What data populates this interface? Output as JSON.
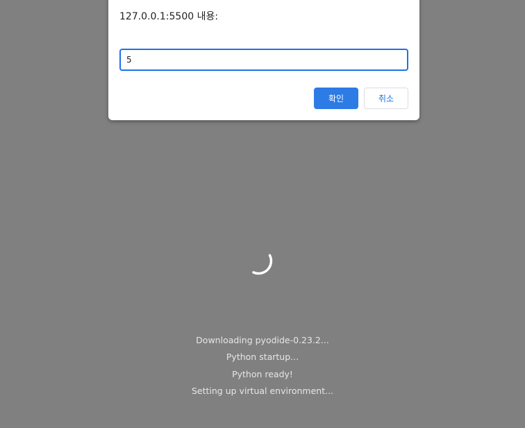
{
  "dialog": {
    "title": "127.0.0.1:5500 내용:",
    "input_value": "5",
    "ok_label": "확인",
    "cancel_label": "취소"
  },
  "loader": {
    "spinner_icon": "loading-spinner-icon",
    "messages": [
      "Downloading pyodide-0.23.2...",
      "Python startup...",
      "Python ready!",
      "Setting up virtual environment..."
    ]
  },
  "colors": {
    "overlay": "#808080",
    "accent": "#2d7be5"
  }
}
